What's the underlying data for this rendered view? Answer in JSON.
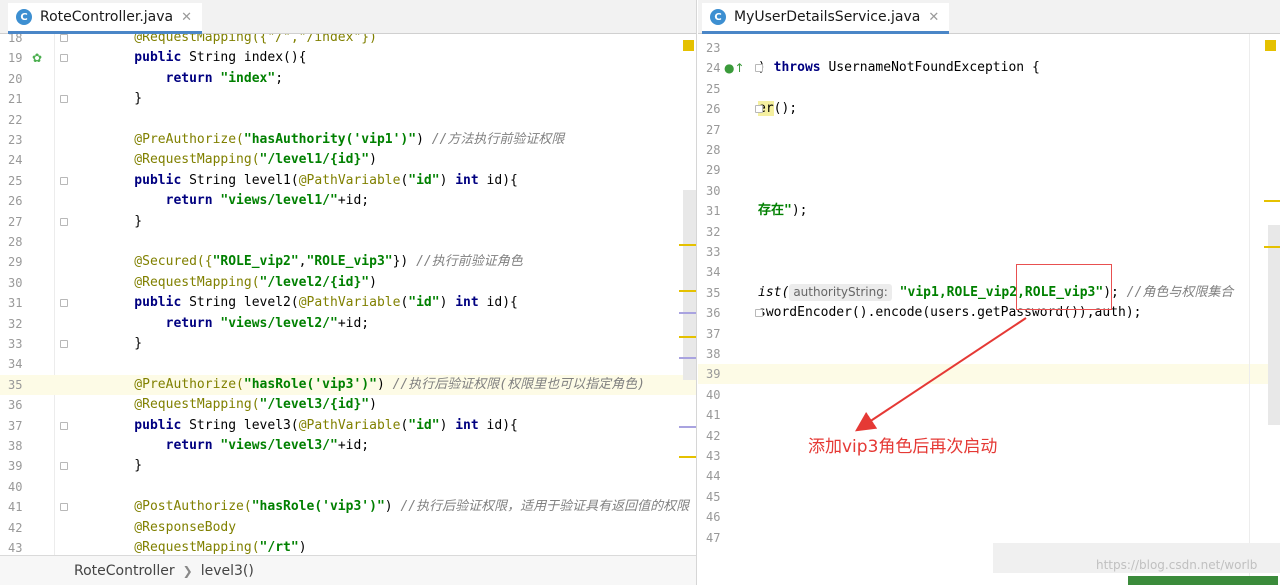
{
  "left_editor": {
    "tab_title": "RoteController.java",
    "tab_icon_letter": "C",
    "breadcrumb": [
      "RoteController",
      "level3()"
    ],
    "lines": [
      {
        "n": "18",
        "top": 0,
        "segments": [
          {
            "t": "    @RequestMapping({\"/\",\"/index\"})",
            "c": "ann"
          }
        ]
      },
      {
        "n": "19",
        "segments": [
          {
            "t": "    public",
            "c": "kw"
          },
          {
            "t": " String index(){",
            "c": ""
          }
        ]
      },
      {
        "n": "20",
        "segments": [
          {
            "t": "        return",
            "c": "kw"
          },
          {
            "t": " \"index\"",
            "c": "str"
          },
          {
            "t": ";",
            "c": ""
          }
        ]
      },
      {
        "n": "21",
        "segments": [
          {
            "t": "    }",
            "c": ""
          }
        ]
      },
      {
        "n": "22",
        "segments": []
      },
      {
        "n": "23",
        "segments": [
          {
            "t": "    @PreAuthorize(",
            "c": "ann"
          },
          {
            "t": "\"hasAuthority('vip1')\"",
            "c": "str"
          },
          {
            "t": ") ",
            "c": ""
          },
          {
            "t": "//方法执行前验证权限",
            "c": "cmt"
          }
        ]
      },
      {
        "n": "24",
        "segments": [
          {
            "t": "    @RequestMapping(",
            "c": "ann"
          },
          {
            "t": "\"/level1/{id}\"",
            "c": "str"
          },
          {
            "t": ")",
            "c": ""
          }
        ]
      },
      {
        "n": "25",
        "segments": [
          {
            "t": "    public",
            "c": "kw"
          },
          {
            "t": " String level1(",
            "c": ""
          },
          {
            "t": "@PathVariable",
            "c": "ann"
          },
          {
            "t": "(",
            "c": ""
          },
          {
            "t": "\"id\"",
            "c": "str"
          },
          {
            "t": ") ",
            "c": ""
          },
          {
            "t": "int",
            "c": "kw"
          },
          {
            "t": " id){",
            "c": ""
          }
        ]
      },
      {
        "n": "26",
        "segments": [
          {
            "t": "        return",
            "c": "kw"
          },
          {
            "t": " \"views/level1/\"",
            "c": "str"
          },
          {
            "t": "+id;",
            "c": ""
          }
        ]
      },
      {
        "n": "27",
        "segments": [
          {
            "t": "    }",
            "c": ""
          }
        ]
      },
      {
        "n": "28",
        "segments": []
      },
      {
        "n": "29",
        "segments": [
          {
            "t": "    @Secured({",
            "c": "ann"
          },
          {
            "t": "\"ROLE_vip2\"",
            "c": "str"
          },
          {
            "t": ",",
            "c": ""
          },
          {
            "t": "\"ROLE_vip3\"",
            "c": "str"
          },
          {
            "t": "}) ",
            "c": ""
          },
          {
            "t": "//执行前验证角色",
            "c": "cmt"
          }
        ]
      },
      {
        "n": "30",
        "segments": [
          {
            "t": "    @RequestMapping(",
            "c": "ann"
          },
          {
            "t": "\"/level2/{id}\"",
            "c": "str"
          },
          {
            "t": ")",
            "c": ""
          }
        ]
      },
      {
        "n": "31",
        "segments": [
          {
            "t": "    public",
            "c": "kw"
          },
          {
            "t": " String level2(",
            "c": ""
          },
          {
            "t": "@PathVariable",
            "c": "ann"
          },
          {
            "t": "(",
            "c": ""
          },
          {
            "t": "\"id\"",
            "c": "str"
          },
          {
            "t": ") ",
            "c": ""
          },
          {
            "t": "int",
            "c": "kw"
          },
          {
            "t": " id){",
            "c": ""
          }
        ]
      },
      {
        "n": "32",
        "segments": [
          {
            "t": "        return",
            "c": "kw"
          },
          {
            "t": " \"views/level2/\"",
            "c": "str"
          },
          {
            "t": "+id;",
            "c": ""
          }
        ]
      },
      {
        "n": "33",
        "segments": [
          {
            "t": "    }",
            "c": ""
          }
        ]
      },
      {
        "n": "34",
        "segments": []
      },
      {
        "n": "35",
        "current": true,
        "segments": [
          {
            "t": "    @PreAuthorize(",
            "c": "ann"
          },
          {
            "t": "\"hasRole('vip3')\"",
            "c": "str"
          },
          {
            "t": ") ",
            "c": ""
          },
          {
            "t": "//执行后验证权限(权限里也可以指定角色)",
            "c": "cmt"
          }
        ]
      },
      {
        "n": "36",
        "segments": [
          {
            "t": "    @RequestMapping(",
            "c": "ann"
          },
          {
            "t": "\"/level3/{id}\"",
            "c": "str"
          },
          {
            "t": ")",
            "c": ""
          }
        ]
      },
      {
        "n": "37",
        "segments": [
          {
            "t": "    public",
            "c": "kw"
          },
          {
            "t": " String level3(",
            "c": ""
          },
          {
            "t": "@PathVariable",
            "c": "ann"
          },
          {
            "t": "(",
            "c": ""
          },
          {
            "t": "\"id\"",
            "c": "str"
          },
          {
            "t": ") ",
            "c": ""
          },
          {
            "t": "int",
            "c": "kw"
          },
          {
            "t": " id){",
            "c": ""
          }
        ]
      },
      {
        "n": "38",
        "segments": [
          {
            "t": "        return",
            "c": "kw"
          },
          {
            "t": " \"views/level3/\"",
            "c": "str"
          },
          {
            "t": "+id;",
            "c": ""
          }
        ]
      },
      {
        "n": "39",
        "segments": [
          {
            "t": "    }",
            "c": ""
          }
        ]
      },
      {
        "n": "40",
        "segments": []
      },
      {
        "n": "41",
        "segments": [
          {
            "t": "    @PostAuthorize(",
            "c": "ann"
          },
          {
            "t": "\"hasRole('vip3')\"",
            "c": "str"
          },
          {
            "t": ") ",
            "c": ""
          },
          {
            "t": "//执行后验证权限，适用于验证具有返回值的权限",
            "c": "cmt"
          }
        ]
      },
      {
        "n": "42",
        "segments": [
          {
            "t": "    @ResponseBody",
            "c": "ann"
          }
        ]
      },
      {
        "n": "43",
        "segments": [
          {
            "t": "    @RequestMapping(",
            "c": "ann"
          },
          {
            "t": "\"/rt\"",
            "c": "str"
          },
          {
            "t": ")",
            "c": ""
          }
        ]
      }
    ]
  },
  "right_editor": {
    "tab_title": "MyUserDetailsService.java",
    "tab_icon_letter": "C",
    "lines": [
      {
        "n": "23",
        "segments": []
      },
      {
        "n": "24",
        "segments": [
          {
            "t": ") ",
            "c": ""
          },
          {
            "t": "throws",
            "c": "kw"
          },
          {
            "t": " UsernameNotFoundException {",
            "c": ""
          }
        ]
      },
      {
        "n": "25",
        "segments": []
      },
      {
        "n": "26",
        "segments": [
          {
            "t": "er",
            "c": "hl"
          },
          {
            "t": "();",
            "c": ""
          }
        ]
      },
      {
        "n": "27",
        "segments": []
      },
      {
        "n": "28",
        "segments": []
      },
      {
        "n": "29",
        "segments": []
      },
      {
        "n": "30",
        "segments": []
      },
      {
        "n": "31",
        "segments": [
          {
            "t": "存在\"",
            "c": "str"
          },
          {
            "t": ");",
            "c": ""
          }
        ]
      },
      {
        "n": "32",
        "segments": []
      },
      {
        "n": "33",
        "segments": []
      },
      {
        "n": "34",
        "segments": []
      },
      {
        "n": "35",
        "segments": [
          {
            "t": "ist(",
            "c": "it"
          },
          {
            "t": "authorityString:",
            "c": "hint"
          },
          {
            "t": " \"vip1,ROLE_vip2,ROLE_vip3\"",
            "c": "str"
          },
          {
            "t": "); ",
            "c": ""
          },
          {
            "t": "//角色与权限集合",
            "c": "cmt"
          }
        ]
      },
      {
        "n": "36",
        "segments": [
          {
            "t": "swordEncoder().encode(users.getPassword()),auth);",
            "c": ""
          }
        ]
      },
      {
        "n": "37",
        "segments": []
      },
      {
        "n": "38",
        "segments": []
      },
      {
        "n": "39",
        "current": true,
        "segments": []
      },
      {
        "n": "40",
        "segments": []
      },
      {
        "n": "41",
        "segments": []
      },
      {
        "n": "42",
        "segments": []
      },
      {
        "n": "43",
        "segments": []
      },
      {
        "n": "44",
        "segments": []
      },
      {
        "n": "45",
        "segments": []
      },
      {
        "n": "46",
        "segments": []
      },
      {
        "n": "47",
        "segments": []
      }
    ]
  },
  "annotation": {
    "text": "添加vip3角色后再次启动",
    "color": "#e53935"
  },
  "watermark": "https://blog.csdn.net/worlb",
  "colors": {
    "keyword": "#000080",
    "annotation": "#808000",
    "string": "#008000",
    "comment": "#808080",
    "current_line": "#fdfbe6",
    "tab_underline": "#4a86c7"
  }
}
